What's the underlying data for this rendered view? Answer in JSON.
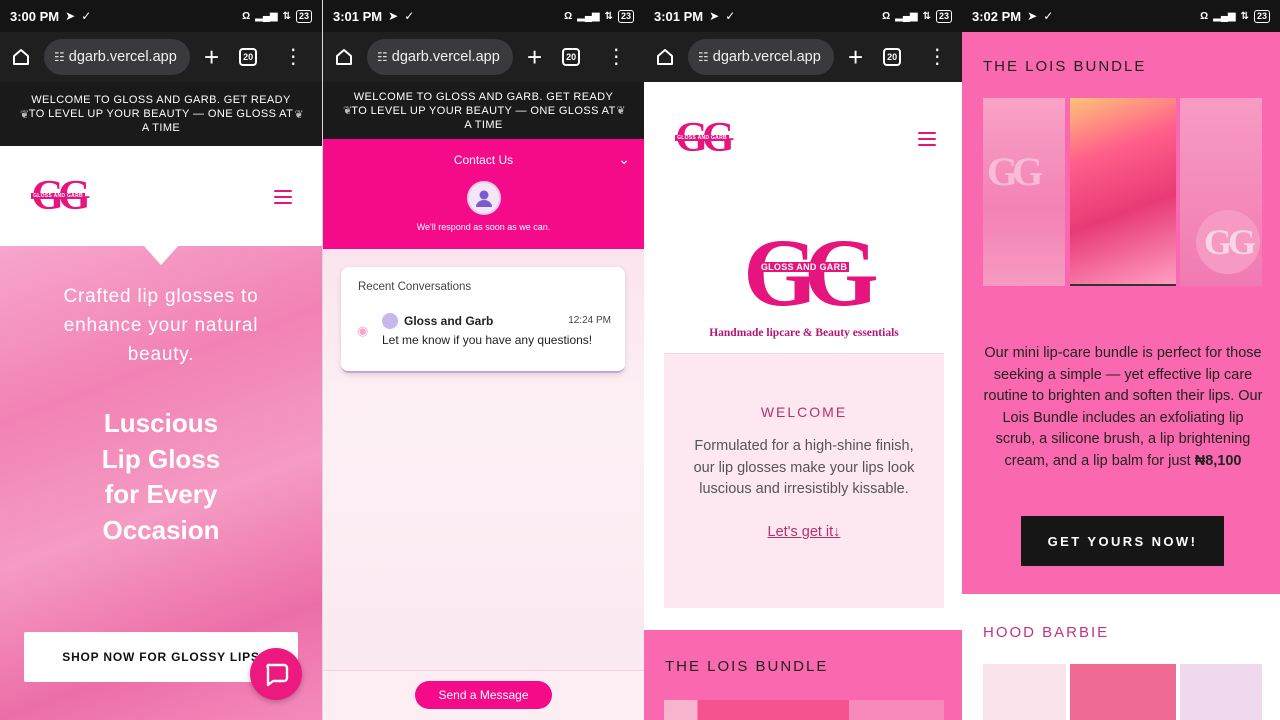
{
  "screens": [
    {
      "time": "3:00 PM",
      "battery": "23",
      "url": "dgarb.vercel.app",
      "tab_count": "20"
    },
    {
      "time": "3:01 PM",
      "battery": "23",
      "url": "dgarb.vercel.app",
      "tab_count": "20"
    },
    {
      "time": "3:01 PM",
      "battery": "23",
      "url": "dgarb.vercel.app",
      "tab_count": "20"
    },
    {
      "time": "3:02 PM",
      "battery": "23"
    }
  ],
  "announcement": "WELCOME TO GLOSS AND GARB. GET READY TO LEVEL UP YOUR BEAUTY — ONE GLOSS AT A TIME",
  "logo": {
    "letters": "GG",
    "name": "GLOSS AND GARB",
    "tagline": "Handmade lipcare & Beauty essentials"
  },
  "hero": {
    "subtitle": "Crafted lip glosses to enhance your natural beauty.",
    "headline": "Luscious Lip Gloss for Every Occasion",
    "cta": "SHOP NOW FOR GLOSSY LIPS"
  },
  "contact": {
    "title": "Contact Us",
    "respond": "We'll respond as soon as we can.",
    "recent_title": "Recent Conversations",
    "conversation": {
      "name": "Gloss and Garb",
      "time": "12:24 PM",
      "message": "Let me know if you have any questions!"
    },
    "send_label": "Send a Message"
  },
  "welcome": {
    "title": "WELCOME",
    "description": "Formulated for a high-shine finish, our lip glosses make your lips look luscious and irresistibly kissable.",
    "link": "Let's get it↓"
  },
  "lois": {
    "title": "THE LOIS BUNDLE",
    "description_pre": "Our mini lip-care bundle is perfect for those seeking a simple — yet effective lip care routine to brighten and soften their lips. Our Lois Bundle includes an exfoliating lip scrub, a silicone brush, a lip brightening cream, and a lip balm for just ",
    "price": "₦8,100",
    "cta": "GET YOURS NOW!"
  },
  "hood": {
    "title": "HOOD BARBIE"
  },
  "colors": {
    "brand_pink": "#e6157e",
    "hot_pink": "#f50a8a",
    "section_pink": "#fa69b0",
    "dark": "#161616"
  }
}
